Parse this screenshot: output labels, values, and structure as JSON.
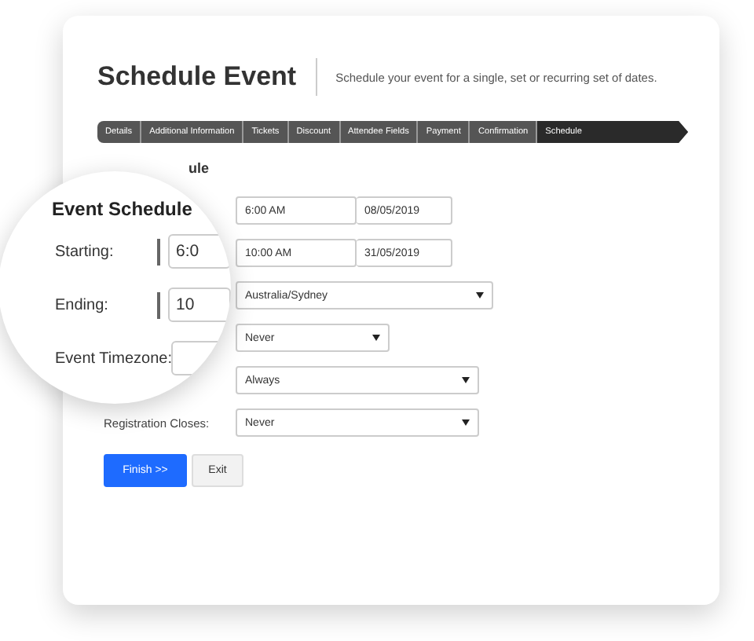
{
  "page": {
    "title": "Schedule Event",
    "subtitle": "Schedule your event for a single, set or recurring set of dates."
  },
  "steps": [
    {
      "label": "Details",
      "selected": false
    },
    {
      "label": "Additional Information",
      "selected": false
    },
    {
      "label": "Tickets",
      "selected": false
    },
    {
      "label": "Discount",
      "selected": false
    },
    {
      "label": "Attendee Fields",
      "selected": false
    },
    {
      "label": "Payment",
      "selected": false
    },
    {
      "label": "Confirmation",
      "selected": false
    },
    {
      "label": "Schedule",
      "selected": true
    }
  ],
  "form": {
    "heading": "ule",
    "rows": [
      {
        "kind": "datetime",
        "time": "6:00 AM",
        "date": "08/05/2019"
      },
      {
        "kind": "datetime",
        "time": "10:00 AM",
        "date": "31/05/2019"
      },
      {
        "kind": "wide-select",
        "value": "Australia/Sydney"
      },
      {
        "kind": "short-select",
        "value": "Never"
      },
      {
        "kind": "select",
        "value": "Always"
      },
      {
        "kind": "select",
        "label": "Registration Closes:",
        "value": "Never"
      }
    ]
  },
  "buttons": [
    {
      "label": "Finish >>",
      "kind": "primary"
    },
    {
      "label": "Exit",
      "kind": "secondary"
    }
  ],
  "magnifier": {
    "heading": "Event Schedule",
    "rows": [
      {
        "label": "Starting:",
        "value": "6:0"
      },
      {
        "label": "Ending:",
        "value": "10"
      },
      {
        "label": "Event Timezone:"
      }
    ]
  }
}
